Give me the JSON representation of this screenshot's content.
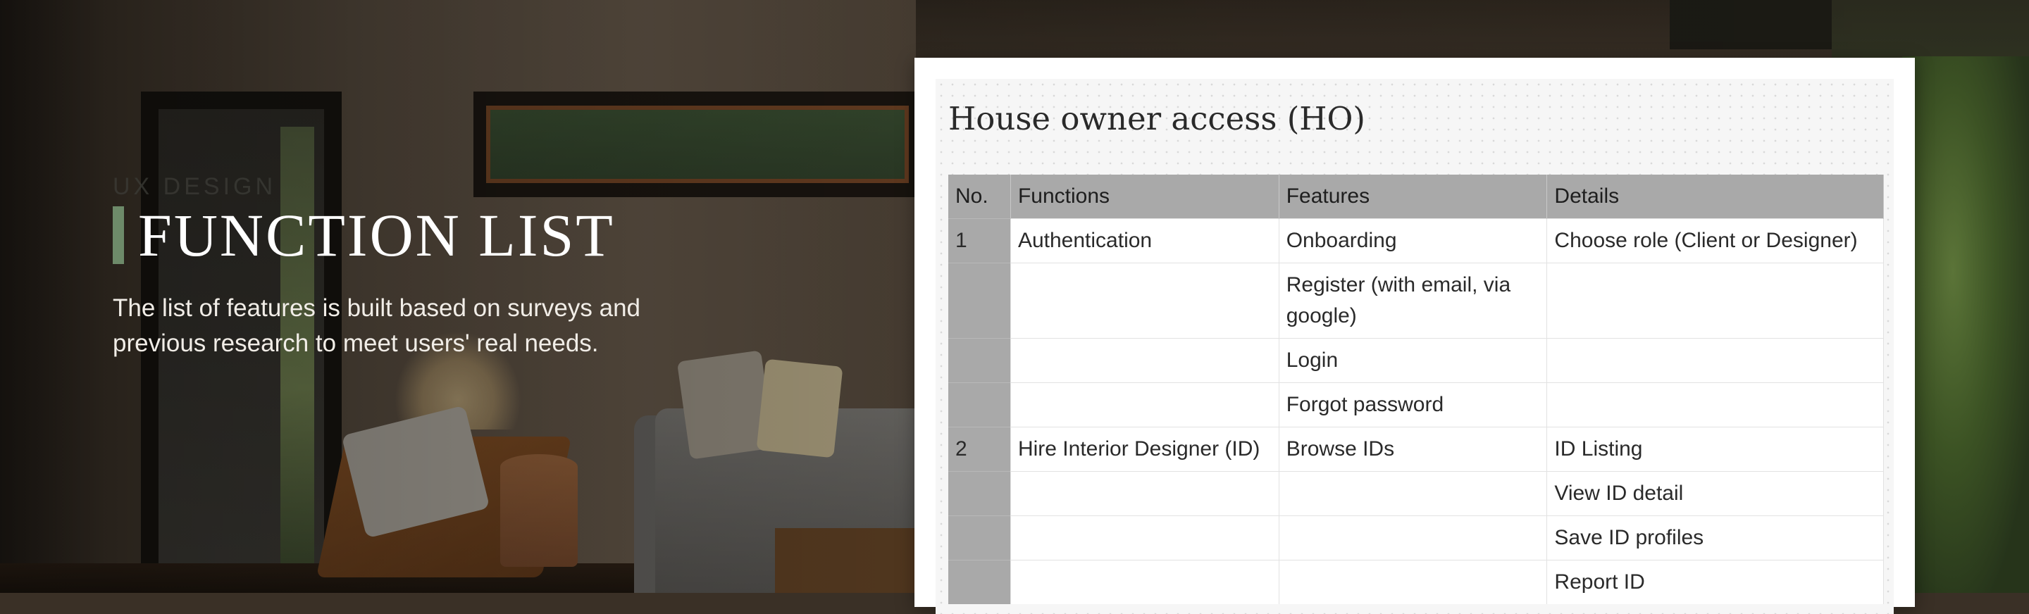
{
  "hero": {
    "eyebrow": "UX DESIGN",
    "title": "FUNCTION LIST",
    "subtitle": "The list of features is built based on surveys and previous research to meet users' real needs."
  },
  "card": {
    "title": "House owner access (HO)",
    "table": {
      "headers": [
        "No.",
        "Functions",
        "Features",
        "Details"
      ],
      "rows": [
        {
          "no": "1",
          "function": "Authentication",
          "feature": "Onboarding",
          "detail": "Choose role (Client or Designer)"
        },
        {
          "no": "",
          "function": "",
          "feature": "Register (with email, via google)",
          "detail": ""
        },
        {
          "no": "",
          "function": "",
          "feature": "Login",
          "detail": ""
        },
        {
          "no": "",
          "function": "",
          "feature": "Forgot password",
          "detail": ""
        },
        {
          "no": "2",
          "function": "Hire Interior Designer (ID)",
          "feature": "Browse IDs",
          "detail": "ID Listing"
        },
        {
          "no": "",
          "function": "",
          "feature": "",
          "detail": "View ID detail"
        },
        {
          "no": "",
          "function": "",
          "feature": "",
          "detail": "Save ID profiles"
        },
        {
          "no": "",
          "function": "",
          "feature": "",
          "detail": "Report ID"
        }
      ]
    }
  },
  "colors": {
    "accent_bar": "#6d8a69",
    "table_header": "#a9a9a9"
  }
}
